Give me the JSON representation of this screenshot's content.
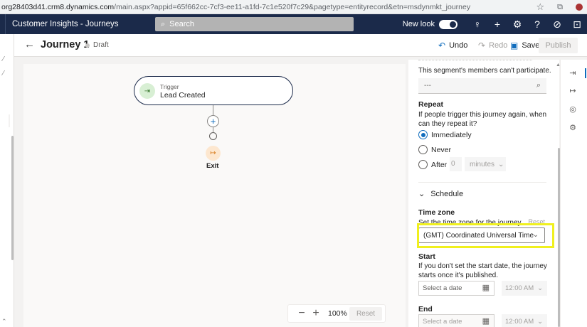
{
  "browser": {
    "url_host": "org28403d41.crm8.dynamics.com",
    "url_path": "/main.aspx?appid=65f662cc-7cf3-ee11-a1fd-7c1e520f7c29&pagetype=entityrecord&etn=msdynmkt_journey"
  },
  "appbar": {
    "title": "Customer Insights - Journeys",
    "search_placeholder": "Search",
    "new_look_label": "New look",
    "help_icon": "?"
  },
  "command_bar": {
    "journey_title": "Journey 1",
    "status": "Draft",
    "undo_label": "Undo",
    "redo_label": "Redo",
    "save_label": "Save",
    "publish_label": "Publish"
  },
  "canvas": {
    "trigger_label": "Trigger",
    "trigger_name": "Lead Created",
    "exit_label": "Exit",
    "zoom_value": "100%",
    "zoom_reset_label": "Reset"
  },
  "panel": {
    "segment_note": "This segment's members can't participate.",
    "segment_placeholder": "---",
    "repeat_heading": "Repeat",
    "repeat_question": "If people trigger this journey again, when can they repeat it?",
    "repeat_options": [
      "Immediately",
      "Never",
      "After"
    ],
    "repeat_selected": "Immediately",
    "after_value": "0",
    "after_unit": "minutes",
    "schedule_heading": "Schedule",
    "timezone_heading": "Time zone",
    "timezone_desc": "Set the time zone for the journey.",
    "timezone_reset": "Reset",
    "timezone_value": "(GMT) Coordinated Universal Time",
    "start_heading": "Start",
    "start_desc": "If you don't set the start date, the journey starts once it's published.",
    "start_date_placeholder": "Select a date",
    "start_time": "12:00 AM",
    "end_heading": "End",
    "end_date_placeholder": "Select a date",
    "end_time": "12:00 AM"
  },
  "colors": {
    "header_bg": "#1b2a4a",
    "accent": "#0f6cbd",
    "highlight": "#f0f01e"
  }
}
